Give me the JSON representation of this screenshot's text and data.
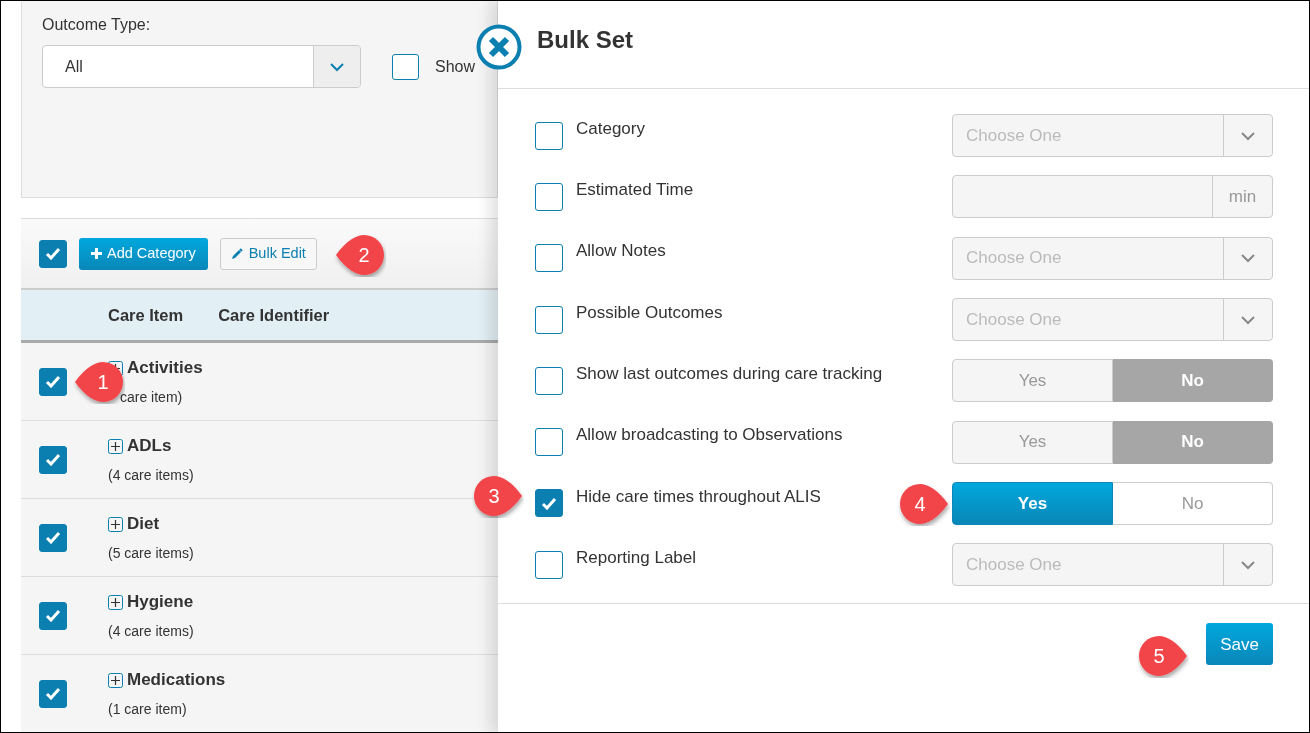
{
  "filters": {
    "outcome_label": "Outcome Type:",
    "outcome_value": "All",
    "show_checkbox": {
      "label": "Show",
      "checked": false
    }
  },
  "toolbar": {
    "select_all_checked": true,
    "add_button": "Add Category",
    "edit_button": "Bulk Edit",
    "edit_callout": "2"
  },
  "columns": [
    "Care Item",
    "Care Identifier"
  ],
  "categories": [
    {
      "name": "Activities",
      "count": "care item)",
      "checked": true,
      "callout": "1"
    },
    {
      "name": "ADLs",
      "count": "(4 care items)",
      "checked": true
    },
    {
      "name": "Diet",
      "count": "(5 care items)",
      "checked": true
    },
    {
      "name": "Hygiene",
      "count": "(4 care items)",
      "checked": true
    },
    {
      "name": "Medications",
      "count": "(1 care item)",
      "checked": true
    }
  ],
  "panel": {
    "title": "Bulk Set",
    "rows": [
      {
        "label": "Category",
        "checked": false,
        "kind": "select",
        "placeholder": "Choose One"
      },
      {
        "label": "Estimated Time",
        "checked": false,
        "kind": "unit",
        "unit": "min"
      },
      {
        "label": "Allow Notes",
        "checked": false,
        "kind": "select",
        "placeholder": "Choose One"
      },
      {
        "label": "Possible Outcomes",
        "checked": false,
        "kind": "select",
        "placeholder": "Choose One"
      },
      {
        "label": "Show last outcomes during care tracking",
        "checked": false,
        "kind": "toggle",
        "options": [
          {
            "label": "Yes",
            "selected": false
          },
          {
            "label": "No",
            "selected": true
          }
        ]
      },
      {
        "label": "Allow broadcasting to Observations",
        "checked": false,
        "kind": "toggle",
        "options": [
          {
            "label": "Yes",
            "selected": false
          },
          {
            "label": "No",
            "selected": true
          }
        ]
      },
      {
        "label": "Hide care times throughout ALIS",
        "checked": true,
        "kind": "toggle",
        "callout": "3",
        "toggle_callout": "4",
        "options": [
          {
            "label": "Yes",
            "selected": true
          },
          {
            "label": "No",
            "selected": false
          }
        ]
      },
      {
        "label": "Reporting Label",
        "checked": false,
        "kind": "select",
        "placeholder": "Choose One"
      }
    ],
    "save_button": "Save",
    "save_callout": "5"
  }
}
